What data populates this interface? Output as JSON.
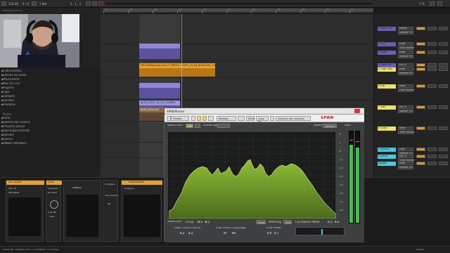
{
  "topbar": {
    "tempo": "130.00",
    "signature": "4 / 4",
    "position": "1 . 1 . 1",
    "loop": "1 Bar",
    "set_title": "Bounce (Ctrl+I)",
    "cpu": "7 %"
  },
  "ruler": {
    "numbers": [
      "17",
      "21",
      "25",
      "29",
      "33",
      "37",
      "41",
      "45",
      "49",
      "53",
      "57"
    ]
  },
  "browser": {
    "items": [
      "Instrumentos",
      "Efectos de audio",
      "MIDI Effects",
      "Max for Live",
      "Plug-Ins",
      "Clips",
      "Samples",
      "Sonidos",
      "Plantillas"
    ],
    "places_header": "Places",
    "places": [
      "Packs",
      "Librería del usuario",
      "Proyecto actual",
      "Descargas librerías",
      "Sonidos",
      "Library",
      "ABNER WAGNER..."
    ]
  },
  "clips": {
    "orange_label": "MELOD/Eldorado BAS IT_BENTS LOOPS_19_EB_BASELINE_C#MAJ",
    "purple_label": "AEXT_LOOP_16_SH_110BPM",
    "brown_label": "BASS_BUILDUP"
  },
  "mixer": {
    "track_names": [
      "1 Bass Line",
      "2 Kick",
      "3 Lead",
      "4 Bassline",
      "5 High Pass",
      "6 Hat",
      "7 Tom",
      "8 Extra",
      "A Reverb",
      "B Delay",
      "Master"
    ],
    "routing_master": "Master",
    "routing_mixer": "Mixer",
    "routing_speaker": "Speaker On",
    "routing_ext_in": "Ext. In",
    "routing_track_volume": "Track Volume",
    "routing_low_pass": "Low Pass",
    "routing_high_pass": "High Pass",
    "routing_in": "In",
    "routing_auto": "Auto",
    "routing_off": "Off",
    "master_in": "1/2",
    "value_a": "0",
    "value_b": "-inf",
    "value_c": "C"
  },
  "span": {
    "title": "SPAN/Master",
    "preset_label": "Presets",
    "routing_label": "Routing",
    "solo_label": "SOLO",
    "copy_label": "Copy to",
    "reset_label": "Reset",
    "promo": "VOXENGO PRO UPGRADE",
    "brand": "SPAN",
    "spectrum_label": "Spectrum",
    "underlay_label": "Underlay",
    "mode_label": "Mode",
    "mode_value": "DEFAULT",
    "out_label": "Out",
    "spectrum_toggle": "ON",
    "statistics_label": "Statistics",
    "integr_label": "Integr",
    "integr_l": "-8.5",
    "integr_r": "-8.5",
    "max_crest_label": "Max Crest Factor",
    "max_crest_l": "8.2",
    "max_crest_r": "8.2",
    "true_peak_clip_label": "True Peak Clippings",
    "true_peak_clip_l": "97",
    "true_peak_clip_r": "66",
    "true_peak_label": "True Peak",
    "true_peak_l": "0.9",
    "true_peak_r": "0.7",
    "reset_btn": "Reset",
    "metering_label": "Metering",
    "metering_value": "RMS",
    "corr_label": "Correlation Meter",
    "corr_l": "0.1",
    "corr_r": "0.2",
    "meter_l_level": 0.85,
    "meter_r_level": 0.82,
    "left_scale": [
      "-6",
      "-12",
      "-18",
      "-24",
      "-30",
      "-36",
      "-42",
      "-48",
      "-54",
      "-60",
      "-66",
      "-72"
    ],
    "right_scale": [
      "6",
      "0",
      "-6",
      "-12",
      "-18",
      "-24",
      "-30",
      "-36",
      "-42",
      "-48"
    ]
  },
  "devices": {
    "d1_title": "Ext. Audio",
    "d1_a": "Ext. In",
    "d1_b": "No Input",
    "d2_title": "SPAN",
    "d2_a": "Sidechain",
    "d2_b": "No Input",
    "d2_c": "0.00 dB",
    "d2_d": "Gain",
    "d3_a": "Default",
    "d3_b": "-inf",
    "d4_a": "Configure",
    "d4_b": "-0% Amount",
    "d4_c": "Off",
    "d5_title": "MMvisualizer",
    "d5_a": "Configure"
  },
  "status": {
    "left": "Interrupt: Máximo 38.3.3 (Timeout: 1/20/768)",
    "right": "Master"
  },
  "colors": {
    "orange": "#e8a02f",
    "purple": "#6a5fb2",
    "yellow": "#ece16b",
    "cyan": "#4ec6df",
    "green": "#7fe14a",
    "spectrum_fill": "#6e9a27"
  }
}
